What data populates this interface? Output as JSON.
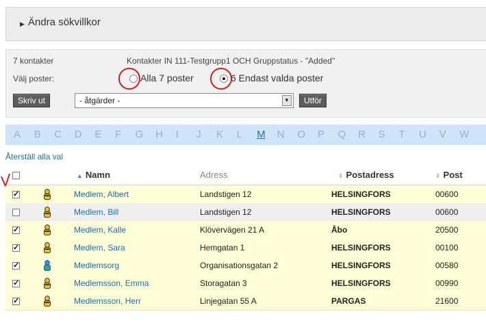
{
  "search": {
    "toggle_label": "Ändra sökvillkor"
  },
  "actions": {
    "count": "7 kontakter",
    "query": "Kontakter IN 111-Testgrupp1 OCH Gruppstatus - \"Added\"",
    "select_label": "Välj poster:",
    "radio_all": "Alla 7 poster",
    "radio_selected": "6 Endast valda poster",
    "print_button": "Skriv ut",
    "dropdown_value": "- åtgärder -",
    "run_button": "Utför"
  },
  "alphabet": {
    "letters": [
      "A",
      "B",
      "C",
      "D",
      "E",
      "F",
      "G",
      "H",
      "I",
      "J",
      "K",
      "L",
      "M",
      "N",
      "O",
      "P",
      "Q",
      "R",
      "S",
      "T",
      "U",
      "V",
      "W"
    ],
    "active": "M"
  },
  "reset_link": "Återställ alla val",
  "columns": {
    "name": "Namn",
    "address": "Adress",
    "postaddress": "Postadress",
    "post": "Post"
  },
  "colors": {
    "selected_row": "#fefed6",
    "alpha_bar": "#cfe4f7",
    "link": "#1a6fb0",
    "annotation": "#cc2222"
  },
  "rows": [
    {
      "checked": true,
      "icon": "person-icon",
      "name": "Medlem, Albert",
      "address": "Landstigen 12",
      "postaddress": "HELSINGFORS",
      "post": "00600"
    },
    {
      "checked": false,
      "icon": "person-icon",
      "name": "Medlem, Bill",
      "address": "Landstigen 12",
      "postaddress": "HELSINGFORS",
      "post": "00600"
    },
    {
      "checked": true,
      "icon": "person-icon",
      "name": "Medlem, Kalle",
      "address": "Klövervägen 21 A",
      "postaddress": "Åbo",
      "post": "20500"
    },
    {
      "checked": true,
      "icon": "person-icon",
      "name": "Medlem, Sara",
      "address": "Hemgatan 1",
      "postaddress": "HELSINGFORS",
      "post": "00100"
    },
    {
      "checked": true,
      "icon": "organization-icon",
      "name": "Medlemsorg",
      "address": "Organisationsgatan 2",
      "postaddress": "HELSINGFORS",
      "post": "00580"
    },
    {
      "checked": true,
      "icon": "person-icon",
      "name": "Medlemsson, Emma",
      "address": "Storagatan 3",
      "postaddress": "HELSINGFORS",
      "post": "00990"
    },
    {
      "checked": true,
      "icon": "person-icon",
      "name": "Medlemsson, Herr",
      "address": "Linjegatan 55 A",
      "postaddress": "PARGAS",
      "post": "21600"
    }
  ]
}
